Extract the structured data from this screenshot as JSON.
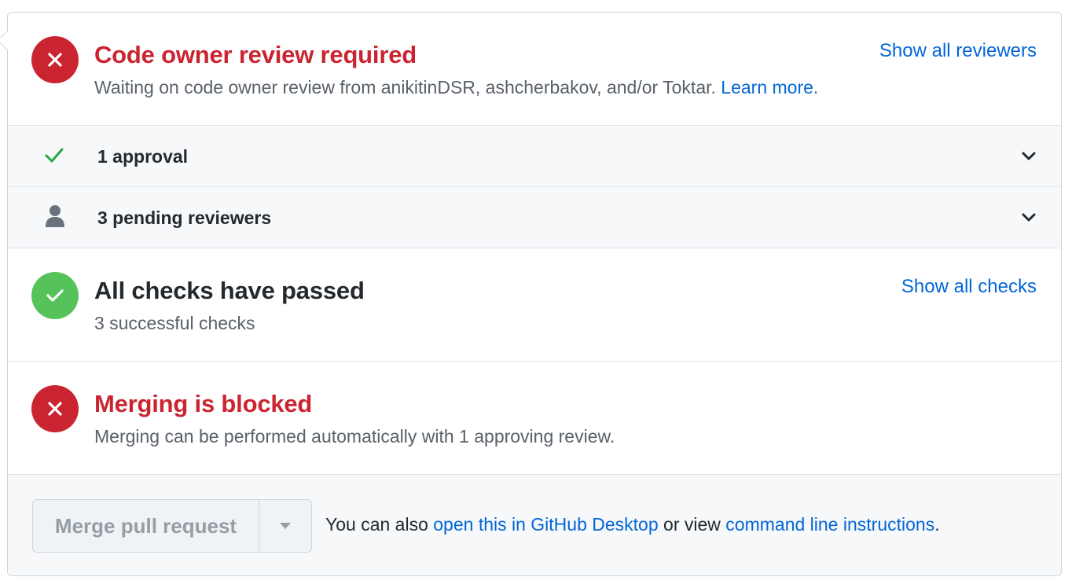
{
  "code_owner": {
    "title": "Code owner review required",
    "description": "Waiting on code owner review from anikitinDSR, ashcherbakov, and/or Toktar.",
    "learn_more": "Learn more.",
    "show_reviewers": "Show all reviewers",
    "icon": "x-icon",
    "status_color": "#cb2431"
  },
  "reviews": {
    "approval_label": "1 approval",
    "pending_label": "3 pending reviewers"
  },
  "checks": {
    "title": "All checks have passed",
    "description": "3 successful checks",
    "show_checks": "Show all checks",
    "icon": "check-icon",
    "status_color": "#56c25a"
  },
  "merge_status": {
    "title": "Merging is blocked",
    "description": "Merging can be performed automatically with 1 approving review.",
    "icon": "x-icon",
    "status_color": "#cb2431"
  },
  "merge_actions": {
    "button_label": "Merge pull request",
    "note_prefix": "You can also",
    "desktop_link": "open this in GitHub Desktop",
    "note_middle": "or view",
    "cli_link": "command line instructions",
    "note_suffix": "."
  }
}
